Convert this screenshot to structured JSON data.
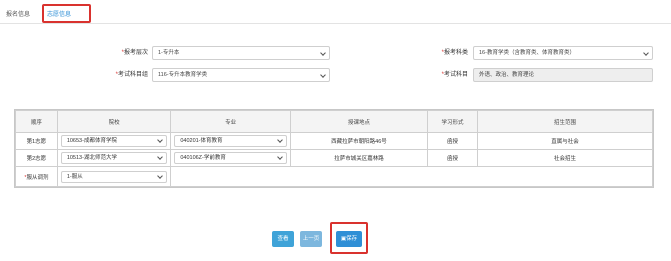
{
  "tabs": [
    "报名信息",
    "志愿信息"
  ],
  "form": {
    "batch": {
      "label": "报考层次",
      "value": "1-专升本"
    },
    "subject_group": {
      "label": "考试科目组",
      "value": "116-专升本教育学类"
    },
    "category": {
      "label": "报考科类",
      "value": "16-教育学类（含教育类、体育教育类）"
    },
    "exam_subjects": {
      "label": "考试科目",
      "value": "外语、政治、教育理论"
    }
  },
  "table": {
    "headers": [
      "顺序",
      "院校",
      "专业",
      "授课地点",
      "学习形式",
      "招生范围"
    ],
    "rows": [
      {
        "order": "第1志愿",
        "school": "10653-成都体育学院",
        "major": "040201-体育教育",
        "location": "西藏拉萨市朝阳路46号",
        "form": "函授",
        "scope": "直属与社会"
      },
      {
        "order": "第2志愿",
        "school": "10513-湖北师范大学",
        "major": "040106Z-学前教育",
        "location": "拉萨市城关区嘉林路",
        "form": "函授",
        "scope": "社会招生"
      }
    ],
    "adjust": {
      "label": "服从调剂",
      "value": "1-服从"
    }
  },
  "buttons": {
    "return": "查看",
    "prev": "上一页",
    "save": "保存"
  }
}
